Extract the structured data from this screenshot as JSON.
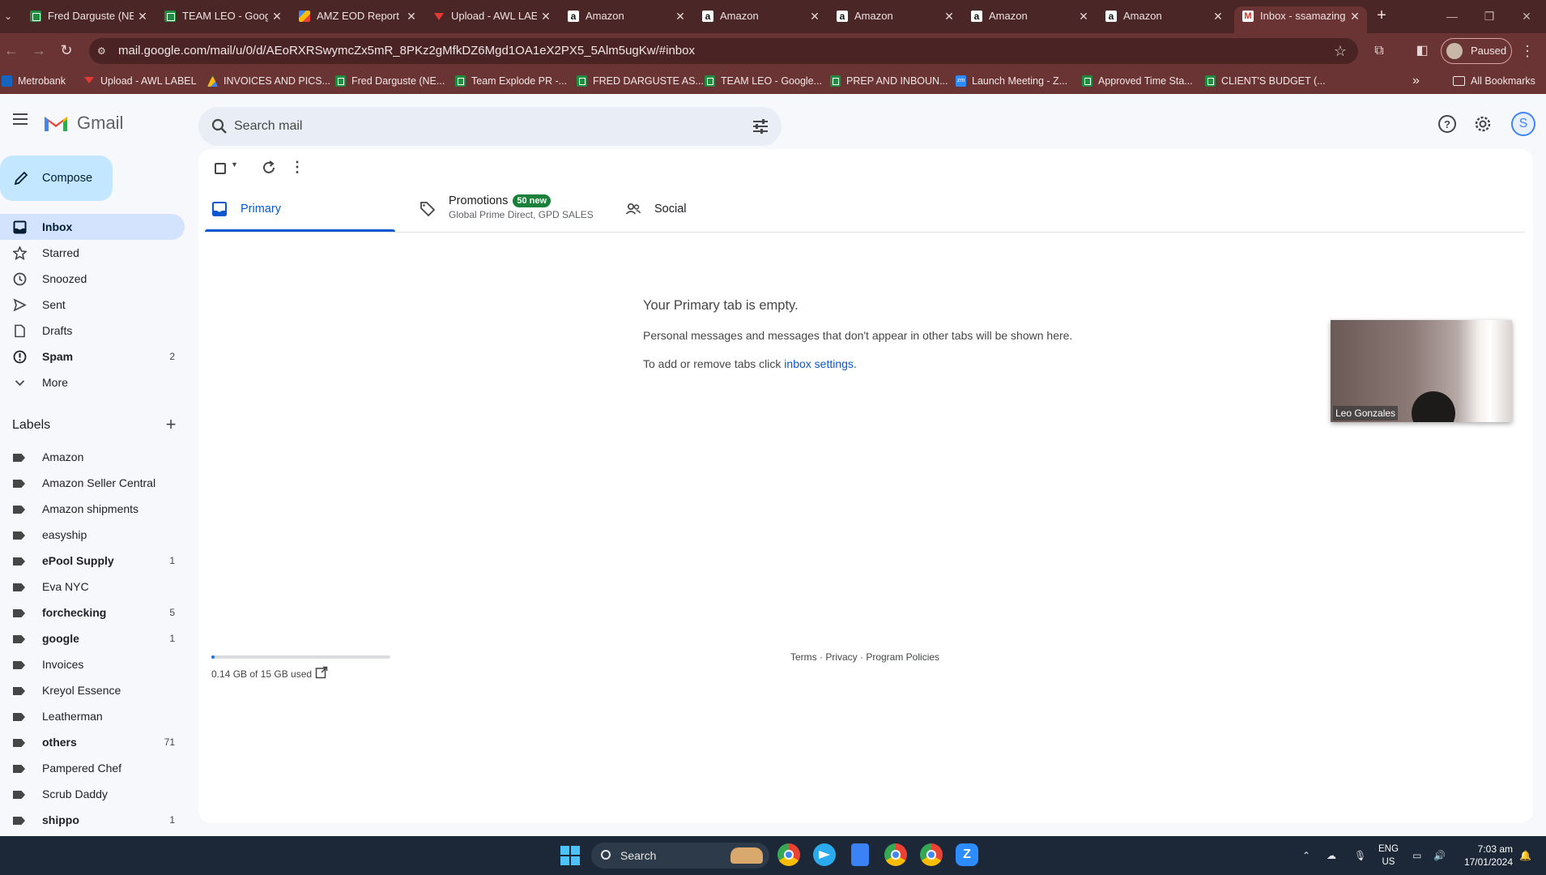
{
  "browser": {
    "tabs": [
      {
        "title": "Fred Darguste (NE",
        "favicon": "sheets-icon"
      },
      {
        "title": "TEAM LEO - Goog",
        "favicon": "sheets-icon"
      },
      {
        "title": "AMZ EOD Report",
        "favicon": "report-icon"
      },
      {
        "title": "Upload - AWL LAE",
        "favicon": "awl-icon"
      },
      {
        "title": "Amazon",
        "favicon": "amazon-icon"
      },
      {
        "title": "Amazon",
        "favicon": "amazon-icon"
      },
      {
        "title": "Amazon",
        "favicon": "amazon-icon"
      },
      {
        "title": "Amazon",
        "favicon": "amazon-icon"
      },
      {
        "title": "Amazon",
        "favicon": "amazon-icon"
      },
      {
        "title": "Inbox - ssamazing",
        "favicon": "gmail-icon"
      }
    ],
    "url": "mail.google.com/mail/u/0/d/AEoRXRSwymcZx5mR_8PKz2gMfkDZ6Mgd1OA1eX2PX5_5Alm5ugKw/#inbox",
    "profile_status": "Paused",
    "bookmarks": [
      "Metrobank",
      "Upload - AWL LABEL",
      "INVOICES AND PICS...",
      "Fred Darguste (NE...",
      "Team Explode PR -...",
      "FRED DARGUSTE AS...",
      "TEAM LEO - Google...",
      "PREP AND INBOUN...",
      "Launch Meeting - Z...",
      "Approved Time Sta...",
      "CLIENT'S BUDGET (..."
    ],
    "all_bookmarks": "All Bookmarks"
  },
  "gmail": {
    "logo_text": "Gmail",
    "search_placeholder": "Search mail",
    "account_initial": "S",
    "compose": "Compose",
    "nav": [
      {
        "label": "Inbox",
        "count": ""
      },
      {
        "label": "Starred",
        "count": ""
      },
      {
        "label": "Snoozed",
        "count": ""
      },
      {
        "label": "Sent",
        "count": ""
      },
      {
        "label": "Drafts",
        "count": ""
      },
      {
        "label": "Spam",
        "count": "2"
      },
      {
        "label": "More",
        "count": ""
      }
    ],
    "labels_heading": "Labels",
    "labels": [
      {
        "label": "Amazon",
        "count": ""
      },
      {
        "label": "Amazon Seller Central",
        "count": ""
      },
      {
        "label": "Amazon shipments",
        "count": ""
      },
      {
        "label": "easyship",
        "count": ""
      },
      {
        "label": "ePool Supply",
        "count": "1"
      },
      {
        "label": "Eva NYC",
        "count": ""
      },
      {
        "label": "forchecking",
        "count": "5"
      },
      {
        "label": "google",
        "count": "1"
      },
      {
        "label": "Invoices",
        "count": ""
      },
      {
        "label": "Kreyol Essence",
        "count": ""
      },
      {
        "label": "Leatherman",
        "count": ""
      },
      {
        "label": "others",
        "count": "71"
      },
      {
        "label": "Pampered Chef",
        "count": ""
      },
      {
        "label": "Scrub Daddy",
        "count": ""
      },
      {
        "label": "shippo",
        "count": "1"
      }
    ],
    "tabs": {
      "primary": "Primary",
      "promotions": "Promotions",
      "promotions_badge": "50 new",
      "promotions_senders": "Global Prime Direct, GPD SALES",
      "social": "Social"
    },
    "empty": {
      "heading": "Your Primary tab is empty.",
      "line1": "Personal messages and messages that don't appear in other tabs will be shown here.",
      "line2_prefix": "To add or remove tabs click ",
      "line2_link": "inbox settings",
      "line2_suffix": "."
    },
    "storage": {
      "text": "0.14 GB of 15 GB used",
      "fraction": 0.0093
    },
    "footer": "Terms · Privacy · Program Policies"
  },
  "video": {
    "participant": "Leo Gonzales"
  },
  "taskbar": {
    "search": "Search",
    "lang_top": "ENG",
    "lang_bottom": "US",
    "time": "7:03 am",
    "date": "17/01/2024"
  },
  "colors": {
    "chrome_frame": "#4a2626",
    "chrome_toolbar": "#6b3434",
    "gmail_selected": "#d3e3fd",
    "compose": "#c2e7ff",
    "primary_blue": "#0b57d0",
    "promotions_badge": "#188038"
  }
}
